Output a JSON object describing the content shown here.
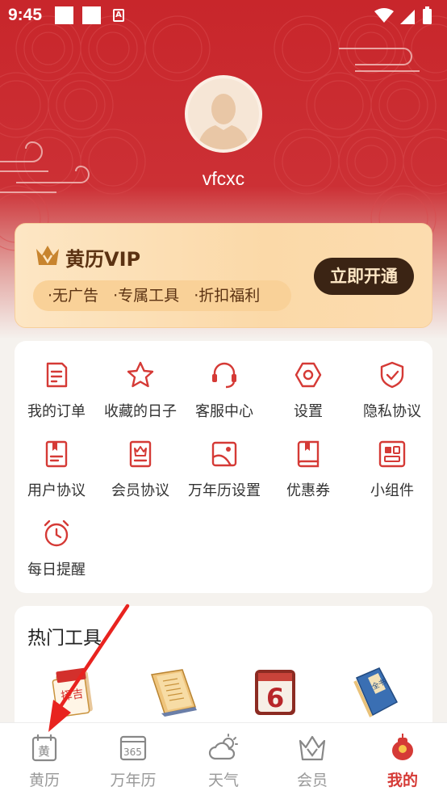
{
  "status_bar": {
    "time": "9:45"
  },
  "profile": {
    "username": "vfcxc"
  },
  "vip": {
    "title": "黄历VIP",
    "perks": [
      "·无广告",
      "·专属工具",
      "·折扣福利"
    ],
    "button": "立即开通"
  },
  "menu": [
    {
      "label": "我的订单",
      "icon": "order-icon"
    },
    {
      "label": "收藏的日子",
      "icon": "star-icon"
    },
    {
      "label": "客服中心",
      "icon": "headset-icon"
    },
    {
      "label": "设置",
      "icon": "settings-icon"
    },
    {
      "label": "隐私协议",
      "icon": "shield-icon"
    },
    {
      "label": "用户协议",
      "icon": "user-agreement-icon"
    },
    {
      "label": "会员协议",
      "icon": "member-agreement-icon"
    },
    {
      "label": "万年历设置",
      "icon": "calendar-settings-icon"
    },
    {
      "label": "优惠券",
      "icon": "coupon-icon"
    },
    {
      "label": "小组件",
      "icon": "widget-icon"
    },
    {
      "label": "每日提醒",
      "icon": "alarm-icon"
    }
  ],
  "hot_tools": {
    "title": "热门工具",
    "items": [
      {
        "icon": "almanac-tool-icon",
        "glyph": "择吉"
      },
      {
        "icon": "book-tool-icon"
      },
      {
        "icon": "calendar-6-tool-icon",
        "glyph": "6"
      },
      {
        "icon": "blue-book-tool-icon",
        "glyph": "全书"
      }
    ]
  },
  "tabs": [
    {
      "label": "黄历",
      "icon": "huangli-tab-icon",
      "glyph": "黄",
      "active": false
    },
    {
      "label": "万年历",
      "icon": "calendar-365-tab-icon",
      "glyph": "365",
      "active": false
    },
    {
      "label": "天气",
      "icon": "weather-tab-icon",
      "active": false
    },
    {
      "label": "会员",
      "icon": "vip-crown-tab-icon",
      "active": false
    },
    {
      "label": "我的",
      "icon": "profile-tab-icon",
      "active": true
    }
  ],
  "colors": {
    "primary": "#c8262b",
    "active_tab": "#d53a36",
    "vip_dark": "#3b2414"
  }
}
